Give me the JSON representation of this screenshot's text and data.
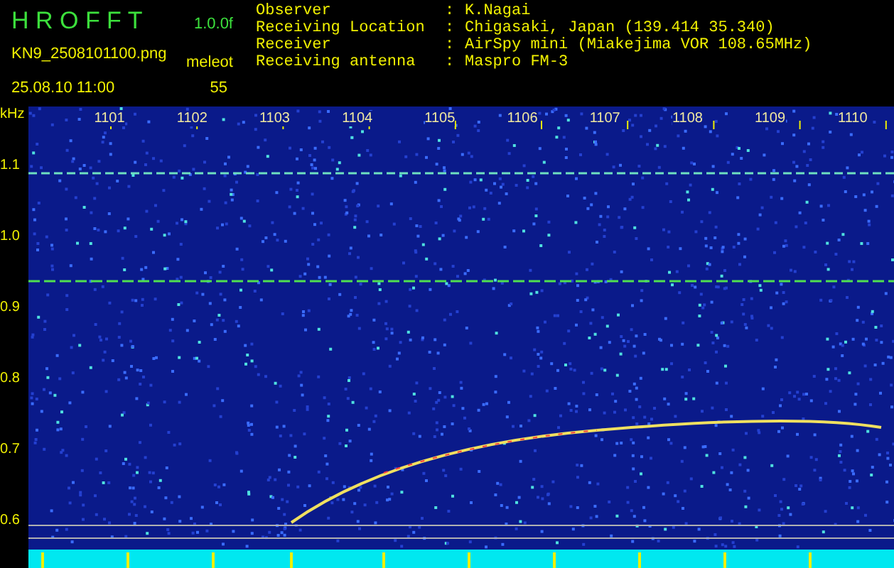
{
  "header": {
    "app_name": "H R O F F T",
    "version": "1.0.0f",
    "filename": "KN9_2508101100.png",
    "date_time": "25.08.10 11:00",
    "mode": "meleot",
    "count": "55"
  },
  "info": [
    {
      "label": "Observer",
      "separator": ":",
      "value": "K.Nagai"
    },
    {
      "label": "Receiving Location",
      "separator": ":",
      "value": "Chigasaki, Japan (139.414 35.340)"
    },
    {
      "label": "Receiver",
      "separator": ":",
      "value": "AirSpy mini (Miakejima VOR 108.65MHz)"
    },
    {
      "label": "Receiving antenna",
      "separator": ":",
      "value": "Maspro FM-3"
    }
  ],
  "y_axis": {
    "unit": "kHz",
    "labels": [
      "1.1",
      "1.0",
      "0.9",
      "0.8",
      "0.7",
      "0.6"
    ]
  },
  "x_axis": {
    "labels": [
      "1101",
      "1102",
      "1103",
      "1104",
      "1105",
      "1106",
      "1107",
      "1108",
      "1109",
      "1110"
    ]
  }
}
